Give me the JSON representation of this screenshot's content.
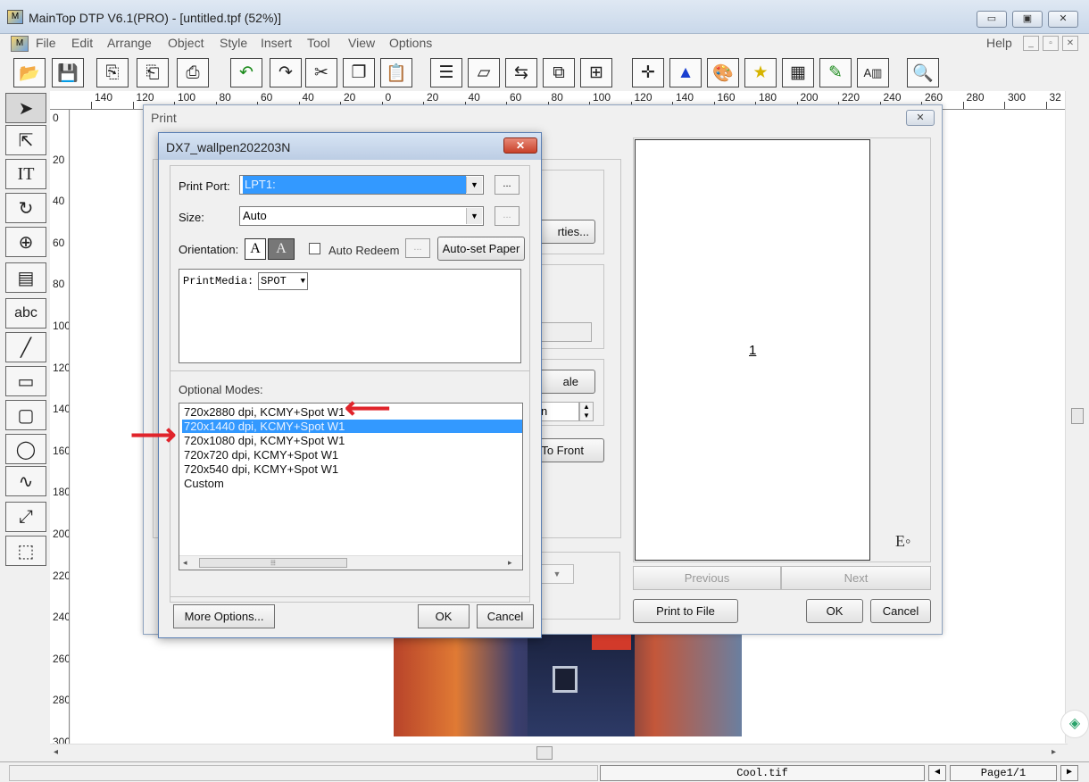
{
  "app": {
    "title": "MainTop DTP V6.1(PRO) - [untitled.tpf (52%)]",
    "menus": [
      "File",
      "Edit",
      "Arrange",
      "Object",
      "Style",
      "Insert",
      "Tool",
      "View",
      "Options"
    ],
    "help": "Help"
  },
  "rulers": {
    "h_ticks": [
      "140",
      "120",
      "100",
      "80",
      "60",
      "40",
      "20",
      "0",
      "20",
      "40",
      "60",
      "80",
      "100",
      "120",
      "140",
      "160",
      "180",
      "200",
      "220",
      "240",
      "260",
      "280",
      "300",
      "32"
    ],
    "v_ticks": [
      "0",
      "20",
      "40",
      "60",
      "80",
      "100",
      "120",
      "140",
      "160",
      "180",
      "200",
      "220",
      "240",
      "260",
      "280",
      "300"
    ]
  },
  "icons": {
    "toolbar": [
      "open-folder-icon",
      "save-icon",
      "import-icon",
      "export-icon",
      "print-icon",
      "undo-icon",
      "redo-icon",
      "cut-icon",
      "copy-icon",
      "paste-icon",
      "align-left-icon",
      "align-skew-icon",
      "distribute-icon",
      "group-icon",
      "table-icon",
      "crosshair-icon",
      "shapes-icon",
      "color-icon",
      "star-icon",
      "grid-map-icon",
      "edit-node-icon",
      "text-format-icon",
      "find-icon"
    ],
    "tools": [
      "pointer-tool-icon",
      "node-tool-icon",
      "text-tool-icon",
      "rotate-tool-icon",
      "zoom-tool-icon",
      "page-tool-icon",
      "abc-text-icon",
      "line-tool-icon",
      "rectangle-tool-icon",
      "rounded-rect-tool-icon",
      "ellipse-tool-icon",
      "curve-tool-icon",
      "dimension-tool-icon",
      "frame-tool-icon"
    ]
  },
  "print_dialog": {
    "title": "Print",
    "properties_label": "rties...",
    "scale_label": "ale",
    "to_front_label": "To Front",
    "spin_value": "n",
    "page_number": "1",
    "previous": "Previous",
    "next": "Next",
    "print_to_file": "Print to File",
    "ok": "OK",
    "cancel": "Cancel"
  },
  "dx7_dialog": {
    "title": "DX7_wallpen202203N",
    "print_port_label": "Print Port:",
    "print_port_value": "LPT1:",
    "size_label": "Size:",
    "size_value": "Auto",
    "orientation_label": "Orientation:",
    "auto_redeem_label": "Auto Redeem",
    "auto_set_paper": "Auto-set Paper",
    "print_media_label": "PrintMedia:",
    "print_media_value": "SPOT",
    "optional_modes_label": "Optional Modes:",
    "modes": [
      "720x2880 dpi, KCMY+Spot W1",
      "720x1440 dpi, KCMY+Spot W1",
      "720x1080 dpi, KCMY+Spot W1",
      "720x720 dpi, KCMY+Spot W1",
      "720x540 dpi, KCMY+Spot W1",
      "Custom"
    ],
    "selected_mode_index": 1,
    "more_options": "More Options...",
    "ok": "OK",
    "cancel": "Cancel",
    "browse": "..."
  },
  "status": {
    "file": "Cool.tif",
    "page": "Page1/1"
  },
  "colors": {
    "selection": "#3399ff",
    "annotation_arrow": "#e0242b"
  }
}
